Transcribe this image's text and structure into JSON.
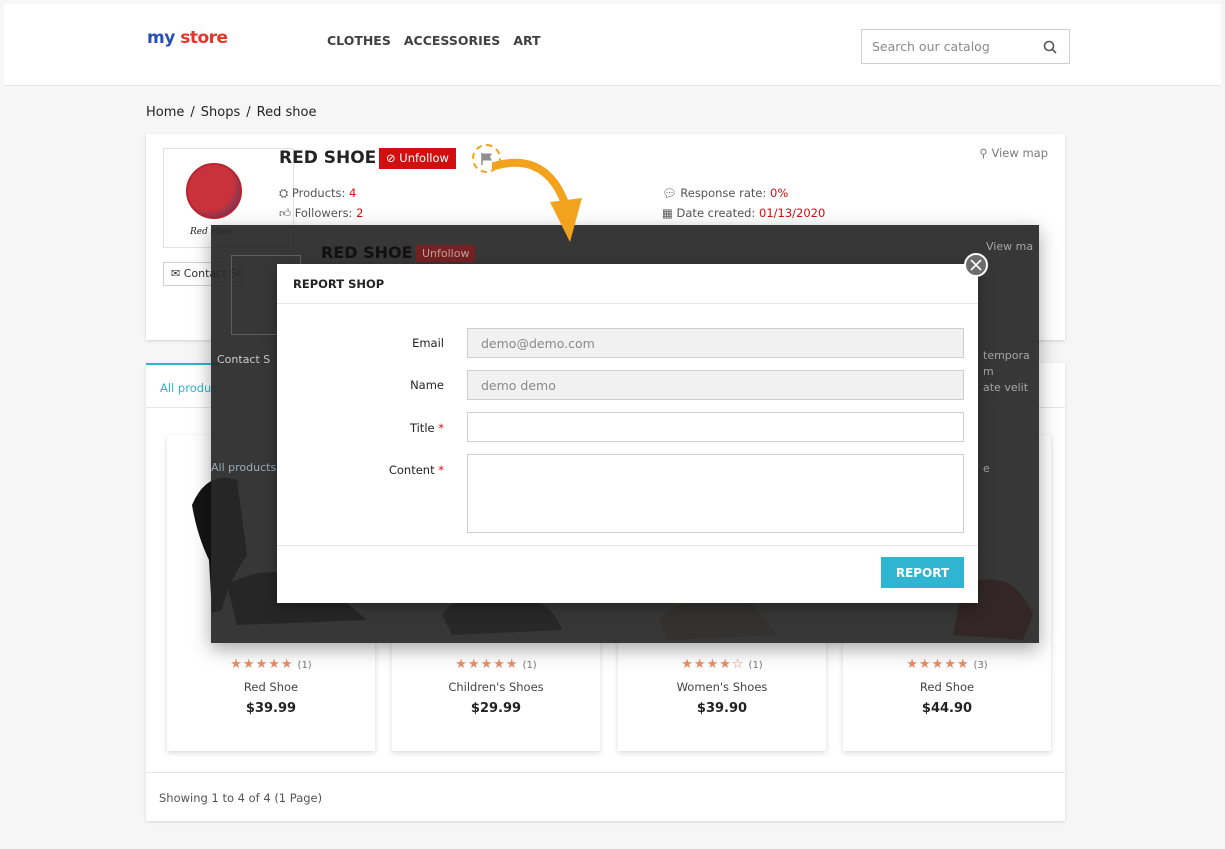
{
  "header": {
    "logo": {
      "part1": "my ",
      "part2": "store"
    },
    "nav": [
      "CLOTHES",
      "ACCESSORIES",
      "ART"
    ],
    "search_placeholder": "Search our catalog"
  },
  "breadcrumb": [
    "Home",
    "Shops",
    "Red shoe"
  ],
  "shop": {
    "logo_text": "Red shoe",
    "title": "RED SHOE",
    "unfollow": "Unfollow",
    "view_map": "View map",
    "contact": "Contact Shop",
    "products_label": "Products:",
    "products_value": "4",
    "followers_label": "Followers:",
    "followers_value": "2",
    "response_label": "Response rate:",
    "response_value": "0%",
    "date_label": "Date created:",
    "date_value": "01/13/2020"
  },
  "ghost": {
    "title": "RED SHOE",
    "unfollow": "Unfollow",
    "view_map": "View ma",
    "contact": "Contact S",
    "tab": "All products (",
    "side1": "tempora",
    "side2": "m",
    "side3": "ate velit",
    "side4": "e"
  },
  "tabs": {
    "all": "All produc"
  },
  "products": [
    {
      "name": "Red Shoe",
      "price": "$39.99",
      "stars": "★★★★★",
      "count": "(1)"
    },
    {
      "name": "Children's Shoes",
      "price": "$29.99",
      "stars": "★★★★★",
      "count": "(1)"
    },
    {
      "name": "Women's Shoes",
      "price": "$39.90",
      "stars": "★★★★☆",
      "count": "(1)"
    },
    {
      "name": "Red Shoe",
      "price": "$44.90",
      "stars": "★★★★★",
      "count": "(3)"
    }
  ],
  "showing": "Showing 1 to 4 of 4 (1 Page)",
  "modal": {
    "title": "REPORT SHOP",
    "email_label": "Email",
    "email_value": "demo@demo.com",
    "name_label": "Name",
    "name_value": "demo demo",
    "title_label": "Title",
    "content_label": "Content",
    "required_mark": "*",
    "report_button": "REPORT"
  },
  "colors": {
    "accent": "#2fb5d2",
    "danger": "#d10f0f",
    "highlight": "#f2a21c",
    "stars": "#e58e68"
  }
}
